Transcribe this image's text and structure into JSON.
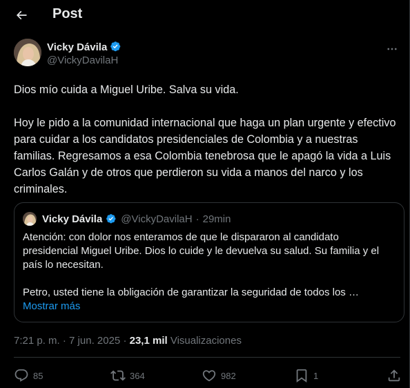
{
  "header": {
    "title": "Post",
    "back_icon": "arrow-left-icon"
  },
  "author": {
    "name": "Vicky Dávila",
    "handle": "@VickyDavilaH",
    "verified_color": "#1d9bf0"
  },
  "post": {
    "paragraphs": [
      "Dios mío cuida a Miguel Uribe. Salva su vida.",
      "Hoy le pido a la comunidad internacional que haga un plan urgente y efectivo para cuidar a los candidatos presidenciales de Colombia y a nuestras familias. Regresamos a esa Colombia tenebrosa que le apagó la vida a Luis Carlos Galán y de otros que perdieron su vida a manos del narco y los criminales."
    ]
  },
  "quote": {
    "name": "Vicky Dávila",
    "handle": "@VickyDavilaH",
    "separator": "·",
    "time": "29min",
    "paragraphs": [
      "Atención: con dolor nos enteramos de que le dispararon al candidato presidencial Miguel Uribe. Dios lo cuide y le devuelva su salud. Su familia y el país lo necesitan.",
      "Petro, usted tiene la obligación de garantizar la seguridad de todos los …"
    ],
    "show_more": "Mostrar más"
  },
  "meta": {
    "time": "7:21 p. m.",
    "separator1": " · ",
    "date": "7 jun. 2025",
    "separator2": " · ",
    "views_count": "23,1 mil",
    "views_label": " Visualizaciones"
  },
  "actions": {
    "replies": "85",
    "reposts": "364",
    "likes": "982",
    "bookmarks": "1"
  },
  "colors": {
    "background": "#000000",
    "text": "#e7e9ea",
    "muted": "#71767b",
    "border": "#2f3336",
    "accent": "#1d9bf0"
  }
}
